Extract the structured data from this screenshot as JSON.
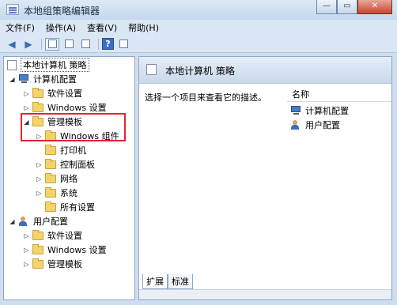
{
  "window": {
    "title": "本地组策略编辑器",
    "controls": [
      "—",
      "▭",
      "✕"
    ]
  },
  "menubar": {
    "items": [
      "文件(F)",
      "操作(A)",
      "查看(V)",
      "帮助(H)"
    ]
  },
  "tree": {
    "root": "本地计算机 策略",
    "computer_config": "计算机配置",
    "cc_software": "软件设置",
    "cc_windows": "Windows 设置",
    "cc_admin": "管理模板",
    "cc_admin_children": [
      "Windows 组件",
      "打印机",
      "控制面板",
      "网络",
      "系统",
      "所有设置"
    ],
    "user_config": "用户配置",
    "uc_software": "软件设置",
    "uc_windows": "Windows 设置",
    "uc_admin": "管理模板"
  },
  "right": {
    "header_title": "本地计算机 策略",
    "description": "选择一个项目来查看它的描述。",
    "column_name": "名称",
    "items": [
      "计算机配置",
      "用户配置"
    ],
    "tabs": [
      "扩展",
      "标准"
    ]
  }
}
